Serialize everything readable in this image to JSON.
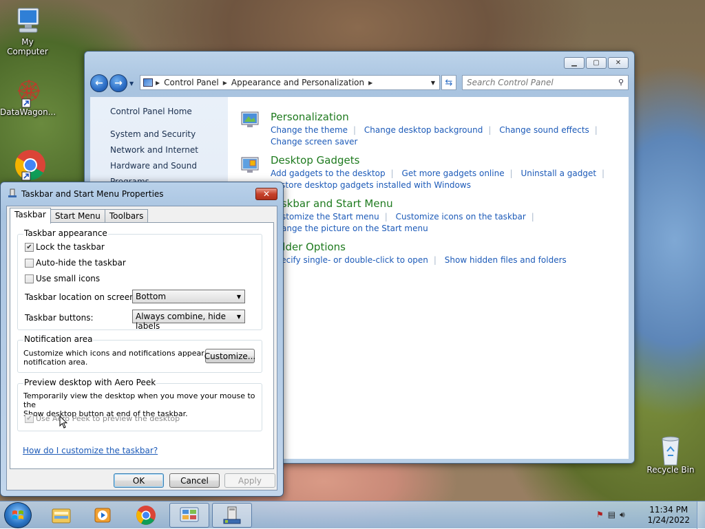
{
  "desktop": {
    "icons": [
      {
        "label": "My Computer",
        "icon": "computer-icon"
      },
      {
        "label": "DataWagon...",
        "icon": "datawagon-shortcut-icon"
      },
      {
        "label": "",
        "icon": "chrome-shortcut-icon"
      },
      {
        "label": "Recycle Bin",
        "icon": "recycle-bin-icon"
      }
    ]
  },
  "control_panel": {
    "address": {
      "crumbs": [
        "Control Panel",
        "Appearance and Personalization"
      ]
    },
    "search_placeholder": "Search Control Panel",
    "left_nav": [
      "Control Panel Home",
      "System and Security",
      "Network and Internet",
      "Hardware and Sound",
      "Programs"
    ],
    "categories": [
      {
        "title": "Personalization",
        "links": [
          "Change the theme",
          "Change desktop background",
          "Change sound effects",
          "Change screen saver"
        ]
      },
      {
        "title": "Desktop Gadgets",
        "links": [
          "Add gadgets to the desktop",
          "Get more gadgets online",
          "Uninstall a gadget",
          "Restore desktop gadgets installed with Windows"
        ]
      },
      {
        "title": "Taskbar and Start Menu",
        "links": [
          "Customize the Start menu",
          "Customize icons on the taskbar",
          "Change the picture on the Start menu"
        ]
      },
      {
        "title": "Folder Options",
        "links": [
          "Specify single- or double-click to open",
          "Show hidden files and folders"
        ]
      }
    ]
  },
  "dialog": {
    "title": "Taskbar and Start Menu Properties",
    "tabs": [
      "Taskbar",
      "Start Menu",
      "Toolbars"
    ],
    "appearance": {
      "group_title": "Taskbar appearance",
      "lock_label": "Lock the taskbar",
      "lock_checked": true,
      "autohide_label": "Auto-hide the taskbar",
      "autohide_checked": false,
      "small_icons_label": "Use small icons",
      "small_icons_checked": false,
      "location_label": "Taskbar location on screen:",
      "location_value": "Bottom",
      "buttons_label": "Taskbar buttons:",
      "buttons_value": "Always combine, hide labels"
    },
    "notification": {
      "group_title": "Notification area",
      "text_line1": "Customize which icons and notifications appear in the",
      "text_line2": "notification area.",
      "customize_button": "Customize..."
    },
    "aero_peek": {
      "group_title": "Preview desktop with Aero Peek",
      "text_line1": "Temporarily view the desktop when you move your mouse to the",
      "text_line2": "Show desktop button at end of the taskbar.",
      "checkbox_label": "Use Aero Peek to preview the desktop",
      "checked": true,
      "disabled": true
    },
    "help_link": "How do I customize the taskbar?",
    "ok_button": "OK",
    "cancel_button": "Cancel",
    "apply_button": "Apply"
  },
  "taskbar": {
    "items": [
      "windows-explorer-icon",
      "media-player-icon",
      "chrome-icon",
      "control-panel-icon",
      "taskbar-properties-icon"
    ],
    "clock_time": "11:34 PM",
    "clock_date": "1/24/2022"
  }
}
